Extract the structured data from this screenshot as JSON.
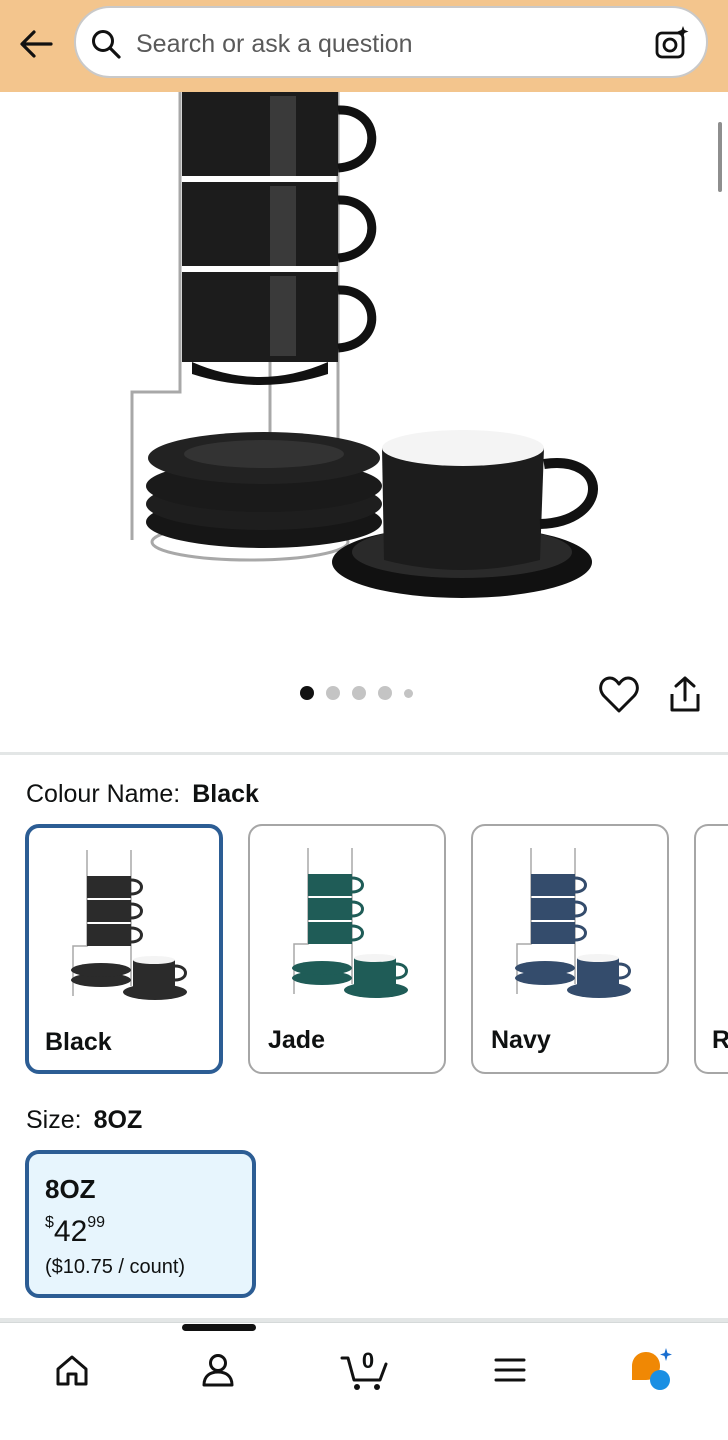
{
  "header": {
    "back_icon": "back-arrow-icon",
    "search_placeholder": "Search or ask a question",
    "search_icon": "search-icon",
    "camera_icon": "camera-sparkle-icon",
    "background_color": "#f3c58d"
  },
  "product": {
    "image_icon": "product-photo",
    "carousel": {
      "total": 5,
      "active": 1
    },
    "wishlist_icon": "heart-icon",
    "share_icon": "share-icon"
  },
  "colour": {
    "label": "Colour Name:",
    "selected": "Black",
    "options": [
      {
        "name": "Black",
        "color": "#2b2b2b",
        "selected": true
      },
      {
        "name": "Jade",
        "color": "#1f5c57",
        "selected": false
      },
      {
        "name": "Navy",
        "color": "#344c6c",
        "selected": false
      },
      {
        "name": "R",
        "color": "#c0c0c0",
        "selected": false
      }
    ]
  },
  "size": {
    "label": "Size:",
    "selected": "8OZ",
    "option": {
      "name": "8OZ",
      "currency": "$",
      "price_whole": "42",
      "price_fraction": "99",
      "unit_price": "($10.75 / count)"
    }
  },
  "bottom_nav": {
    "items": [
      "home-icon",
      "account-icon",
      "cart-icon",
      "menu-icon",
      "rufus-assistant-icon"
    ],
    "cart_count": "0",
    "accent_color": "#f08804"
  }
}
